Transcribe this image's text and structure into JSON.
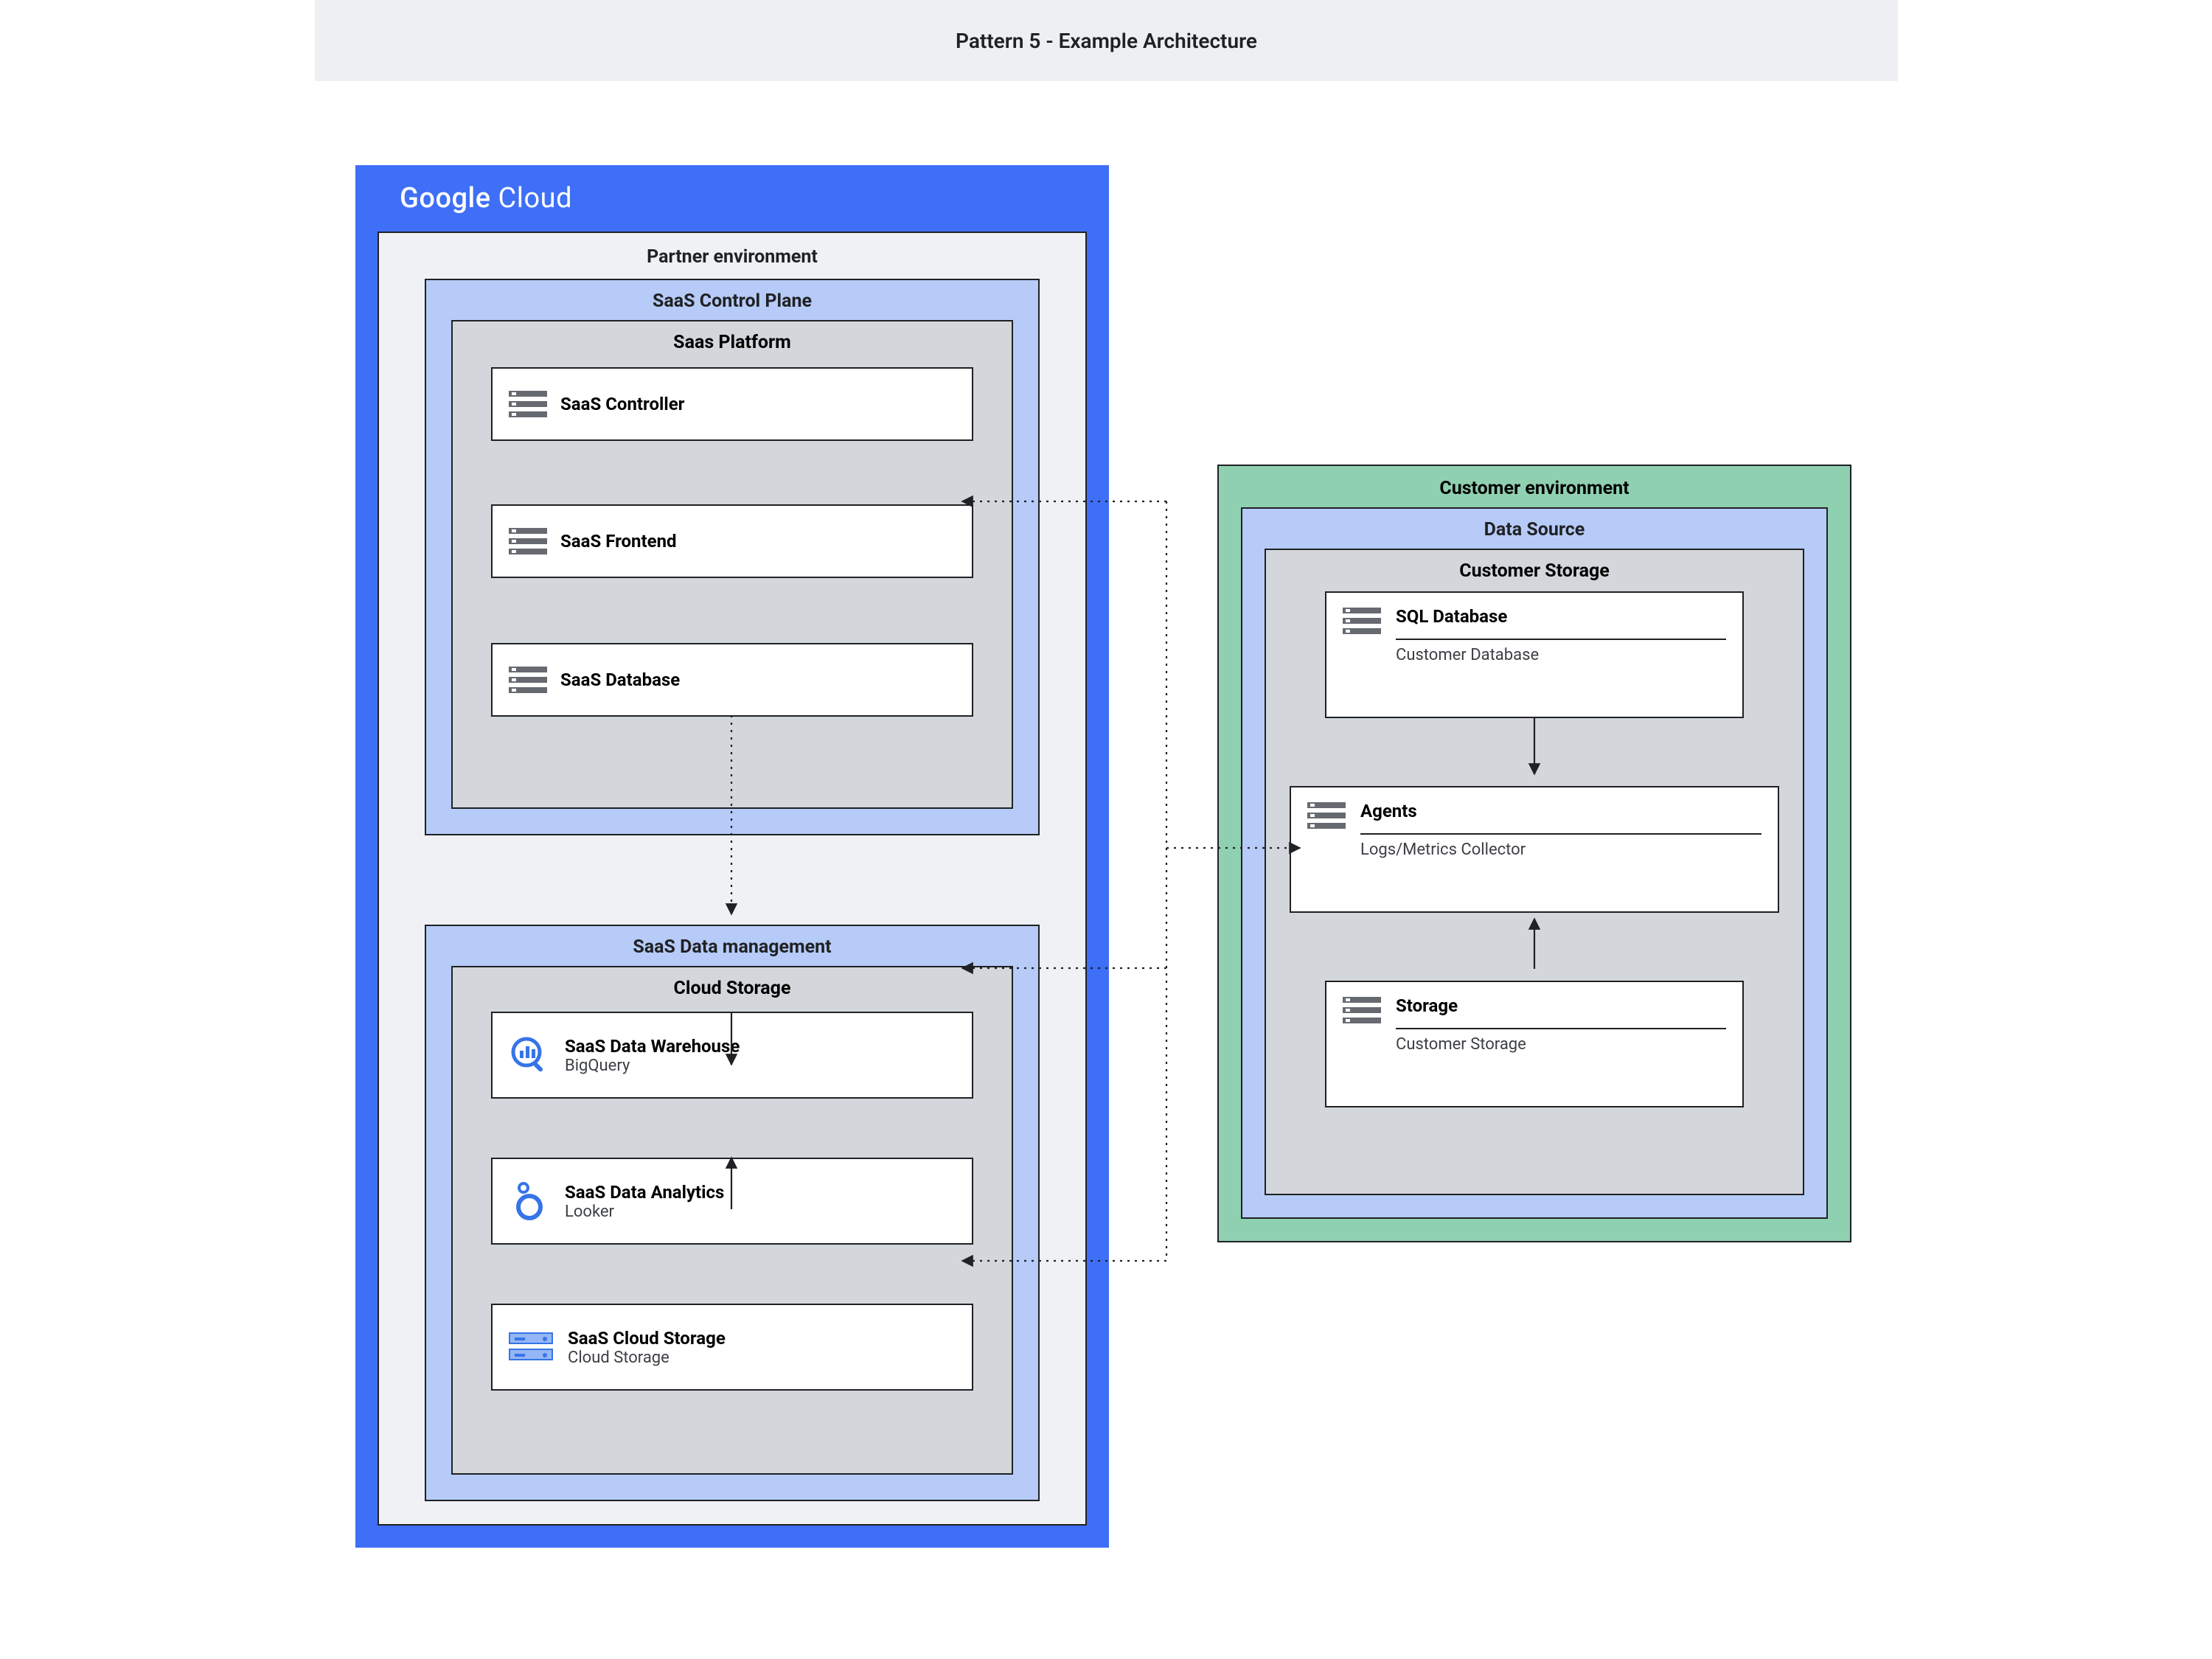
{
  "header": {
    "title": "Pattern 5 - Example Architecture"
  },
  "googleCloud": {
    "brand_google": "Google",
    "brand_cloud": "Cloud",
    "partner_env_label": "Partner environment",
    "control_plane": {
      "label": "SaaS Control Plane",
      "platform_label": "Saas Platform",
      "services": [
        {
          "title": "SaaS Controller"
        },
        {
          "title": "SaaS Frontend"
        },
        {
          "title": "SaaS Database"
        }
      ]
    },
    "data_mgmt": {
      "label": "SaaS Data management",
      "storage_label": "Cloud Storage",
      "services": [
        {
          "title": "SaaS Data Warehouse",
          "sub": "BigQuery"
        },
        {
          "title": "SaaS Data Analytics",
          "sub": "Looker"
        },
        {
          "title": "SaaS Cloud Storage",
          "sub": "Cloud Storage"
        }
      ]
    }
  },
  "customer": {
    "env_label": "Customer environment",
    "data_source_label": "Data Source",
    "storage_label": "Customer Storage",
    "boxes": [
      {
        "title": "SQL Database",
        "sub": "Customer Database"
      },
      {
        "title": "Agents",
        "sub": "Logs/Metrics Collector"
      },
      {
        "title": "Storage",
        "sub": "Customer Storage"
      }
    ]
  },
  "colors": {
    "google_blue": "#3e6ff6",
    "light_blue": "#b6cbf7",
    "grey_fill": "#d3d6db",
    "page_grey": "#eff1f4",
    "green": "#8fd0b0"
  }
}
